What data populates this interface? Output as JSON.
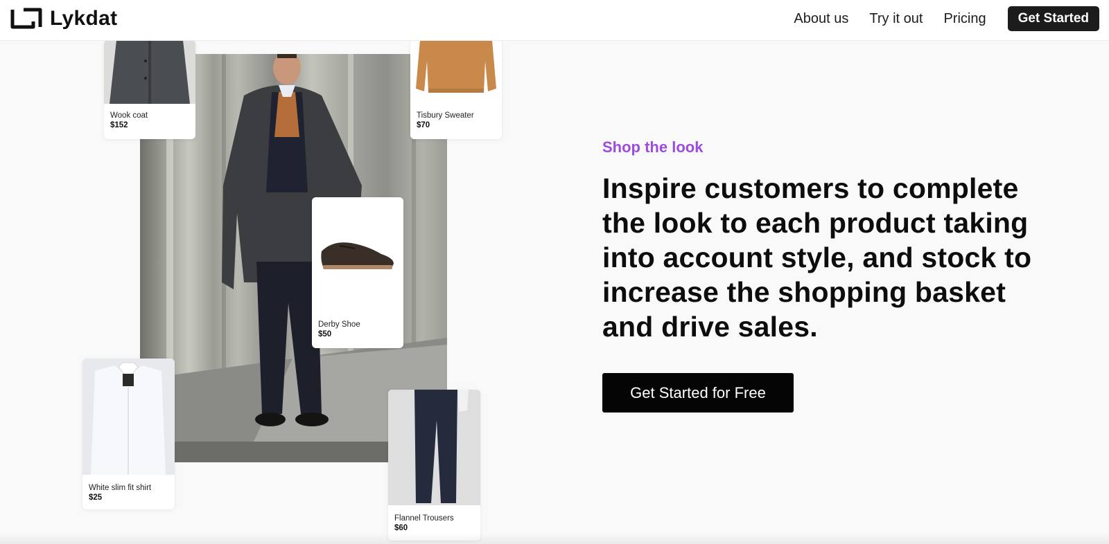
{
  "brand": {
    "name": "Lykdat",
    "logo_icon": "lykdat-logo-icon"
  },
  "nav": {
    "links": [
      "About us",
      "Try it out",
      "Pricing"
    ],
    "cta_label": "Get Started"
  },
  "hero": {
    "eyebrow": "Shop the look",
    "headline": "Inspire customers to complete the look to each product taking into account style, and stock to increase the shopping basket and drive sales.",
    "cta_label": "Get Started for Free"
  },
  "products": [
    {
      "name": "Wook coat",
      "price": "$152"
    },
    {
      "name": "Tisbury Sweater",
      "price": "$70"
    },
    {
      "name": "Derby Shoe",
      "price": "$50"
    },
    {
      "name": "White slim fit shirt",
      "price": "$25"
    },
    {
      "name": "Flannel Trousers",
      "price": "$60"
    }
  ],
  "colors": {
    "accent": "#9b4ddb",
    "nav_button": "#1c1c1c",
    "cta_button": "#050505",
    "background": "#f9f9f9"
  }
}
